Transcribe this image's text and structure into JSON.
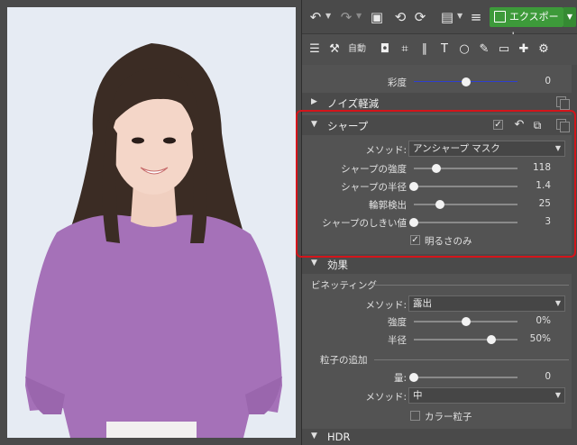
{
  "toolbar": {
    "export_label": "エクスポート",
    "tools_auto_label": "自動"
  },
  "saturation_row": {
    "label": "彩度",
    "value": "0",
    "level": 0.5
  },
  "noise_section": {
    "title": "ノイズ軽減"
  },
  "sharp_section": {
    "title": "シャープ",
    "method_label": "メソッド:",
    "method_value": "アンシャープ マスク",
    "sliders": [
      {
        "label": "シャープの強度",
        "value": "118",
        "level": 0.22
      },
      {
        "label": "シャープの半径",
        "value": "1.4",
        "level": 0.0
      },
      {
        "label": "輪郭検出",
        "value": "25",
        "level": 0.25
      },
      {
        "label": "シャープのしきい値",
        "value": "3",
        "level": 0.0
      }
    ],
    "brightness_only_label": "明るさのみ",
    "brightness_only_checked": true
  },
  "effects_section": {
    "title": "効果",
    "vignetting": {
      "title": "ビネッティング",
      "method_label": "メソッド:",
      "method_value": "露出",
      "sliders": [
        {
          "label": "強度",
          "value": "0%",
          "level": 0.5
        },
        {
          "label": "半径",
          "value": "50%",
          "level": 0.75
        }
      ]
    },
    "grain": {
      "title": "粒子の追加",
      "amount_label": "量:",
      "amount_value": "0",
      "amount_level": 0.0,
      "method_label": "メソッド:",
      "method_value": "中",
      "color_grain_label": "カラー粒子",
      "color_grain_checked": false
    }
  },
  "hdr_section": {
    "title": "HDR"
  },
  "colors": {
    "export_green": "#3d9a3a",
    "highlight_red": "#d4151b",
    "saturation_track": "#2f3fd0"
  }
}
